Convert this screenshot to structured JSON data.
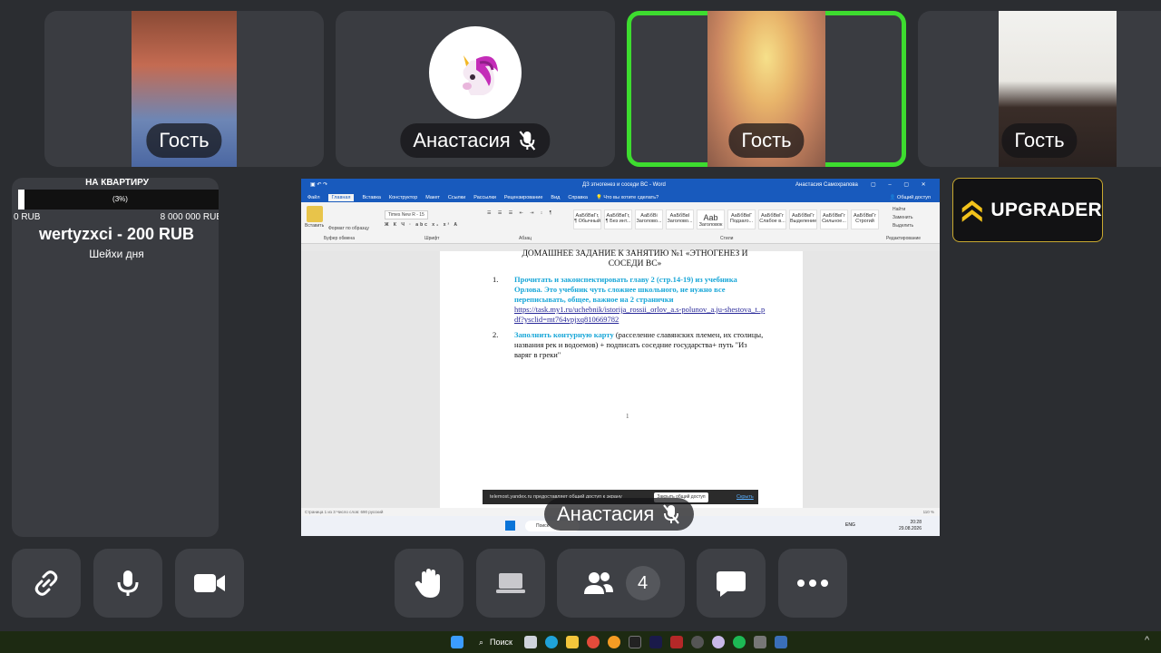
{
  "participants": [
    {
      "name": "Гость",
      "muted": false,
      "active": false
    },
    {
      "name": "Анастасия",
      "muted": true,
      "active": false
    },
    {
      "name": "Гость",
      "muted": false,
      "active": true
    },
    {
      "name": "Гость",
      "muted": false,
      "active": false
    }
  ],
  "donation": {
    "title": "НА КВАРТИРУ",
    "percent_label": "(3%)",
    "progress": 0.03,
    "min": "0 RUB",
    "max": "8 000 000 RUB",
    "top_donor": "wertyzxci - 200 RUB",
    "caption": "Шейхи дня"
  },
  "shared_screen": {
    "presenter": "Анастасия",
    "window_title": "ДЗ этногенез и соседи ВС - Word",
    "user": "Анастасия Самохрапова",
    "search_hint": "Что вы хотите сделать?",
    "share_button": "Общий доступ",
    "tabs": [
      "Файл",
      "Главная",
      "Вставка",
      "Конструктор",
      "Макет",
      "Ссылки",
      "Рассылки",
      "Рецензирование",
      "Вид",
      "Справка"
    ],
    "font_name": "Times New R",
    "font_size": "15",
    "styles": [
      "АаБбВвГг,",
      "АаБбВвГг,",
      "АаБбВі",
      "АаБбВвІ",
      "Ааb",
      "АаБбВвГ",
      "АаБбВвГг",
      "АаБбВвГг",
      "АаБбВвГг",
      "АаБбВвГг"
    ],
    "style_names": [
      "¶ Обычный",
      "¶ Без инт...",
      "Заголово...",
      "Заголово...",
      "Заголовок",
      "Подзаго...",
      "Слабое в...",
      "Выделение",
      "Сильное...",
      "Строгий"
    ],
    "ribbon_groups": [
      "Буфер обмена",
      "Шрифт",
      "Абзац",
      "Стили",
      "Редактирование"
    ],
    "ribbon_actions": [
      "Вставить",
      "Формат по образцу",
      "Найти",
      "Заменить",
      "Выделить"
    ],
    "doc_heading_line1": "ДОМАШНЕЕ ЗАДАНИЕ К ЗАНЯТИЮ №1 «ЭТНОГЕНЕЗ И",
    "doc_heading_line2": "СОСЕДИ ВС»",
    "item1_num": "1.",
    "item1_hl": "Прочитать и законспектировать главу 2 (стр.14-19) из учебника Орлова. Это учебник чуть сложнее школьного, не нужно все переписывать, общее, важное на 2 странички",
    "item1_link": "https://task.my1.ru/uchebnik/istorija_rossii_orlov_a.s-polunov_a.ju-shestova_t..pdf?ysclid=mt764vpjxq810669782",
    "item2_num": "2.",
    "item2_hl": "Заполнить контурную карту",
    "item2_text": " (расселение славянских племен, их столицы, названия рек и водоемов) + подписать соседние государства+ путь \"Из варяг в греки\"",
    "page_mark": "1",
    "notice_text": "telemost.yandex.ru предоставляет общий доступ к экрану",
    "notice_button": "Закрыть общий доступ",
    "notice_hide": "Скрыть",
    "status": "Страница 1 из 3    Число слов: 690    русский",
    "taskbar_search": "Поиск",
    "lang": "ENG",
    "time": "20:28",
    "date": "29.08.2026",
    "zoom": "110 %"
  },
  "brand": {
    "name": "UPGRADER",
    "accent": "#f2c21b"
  },
  "controls": {
    "participants_count": "4",
    "buttons": [
      "link-icon",
      "mic-icon",
      "camera-icon",
      "raise-hand-icon",
      "screen-share-icon",
      "participants-icon",
      "chat-icon",
      "more-icon"
    ]
  },
  "taskbar": {
    "search": "Поиск"
  },
  "colors": {
    "active_speaker": "#3ddc2f",
    "tile": "#3a3c41",
    "word_blue": "#185abd",
    "highlight_text": "#1aa7d8"
  }
}
